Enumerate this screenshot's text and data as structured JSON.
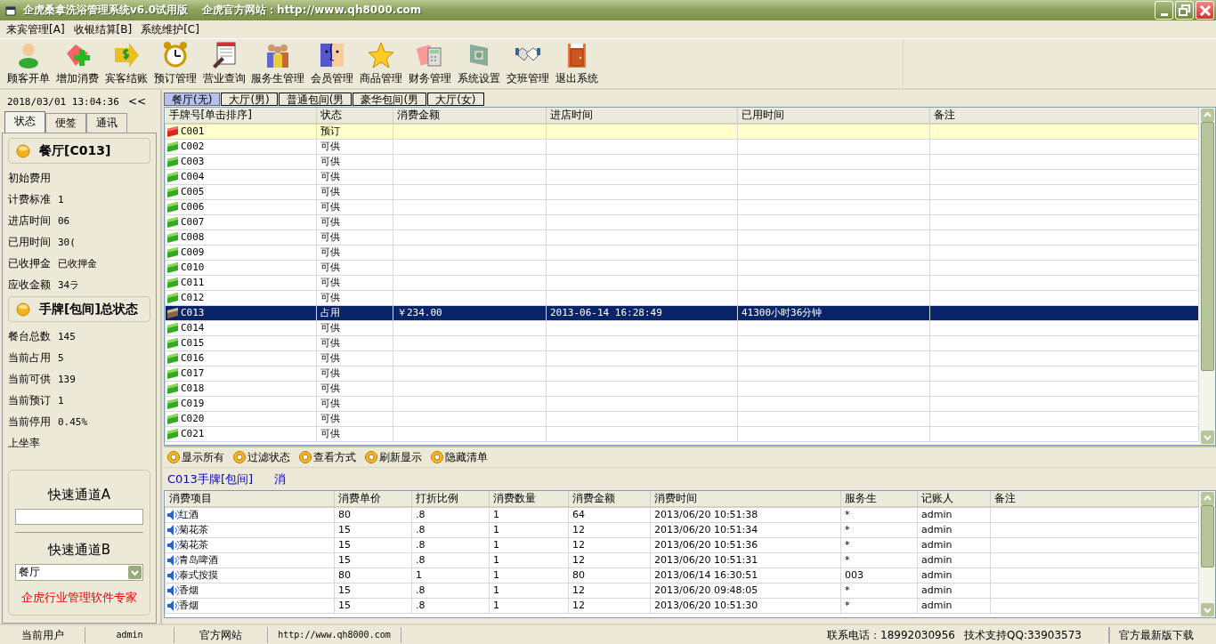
{
  "window": {
    "title": "企虎桑拿洗浴管理系统v6.0试用版",
    "site": "企虎官方网站：http://www.qh8000.com"
  },
  "menu": [
    "来宾管理[A]",
    "收银结算[B]",
    "系统维护[C]"
  ],
  "toolbar": [
    {
      "label": "顾客开单",
      "kind": "person"
    },
    {
      "label": "增加消费",
      "kind": "add"
    },
    {
      "label": "宾客结账",
      "kind": "money"
    },
    {
      "label": "预订管理",
      "kind": "clock"
    },
    {
      "label": "营业查询",
      "kind": "notepad"
    },
    {
      "label": "服务生管理",
      "kind": "people"
    },
    {
      "label": "会员管理",
      "kind": "face"
    },
    {
      "label": "商品管理",
      "kind": "star"
    },
    {
      "label": "财务管理",
      "kind": "calculator"
    },
    {
      "label": "系统设置",
      "kind": "settings"
    },
    {
      "label": "交班管理",
      "kind": "handshake"
    },
    {
      "label": "退出系统",
      "kind": "exit"
    }
  ],
  "sidebar": {
    "datetime": "2018/03/01 13:04:36",
    "collapse": "<<",
    "tabs": [
      {
        "label": "状态",
        "selected": true
      },
      {
        "label": "便签",
        "selected": false
      },
      {
        "label": "通讯",
        "selected": false
      }
    ],
    "room_header": "餐厅[C013]",
    "room_fields": [
      {
        "label": "初始费用"
      },
      {
        "label": "计费标准",
        "value": "1"
      },
      {
        "label": "进店时间",
        "value": "06"
      },
      {
        "label": "已用时间",
        "value": "30("
      },
      {
        "label": "已收押金",
        "value": "已收押金"
      },
      {
        "label": "应收金额",
        "value": "34ラ"
      }
    ],
    "summary_header": "手牌[包间]总状态",
    "summary_fields": [
      {
        "label": "餐台总数",
        "value": "145"
      },
      {
        "label": "当前占用",
        "value": "5"
      },
      {
        "label": "当前可供",
        "value": "139"
      },
      {
        "label": "当前预订",
        "value": "1"
      },
      {
        "label": "当前停用",
        "value": "0.45%"
      },
      {
        "label": "上坐率"
      }
    ],
    "quick_a": {
      "label": "快速通道A"
    },
    "quick_b": {
      "label": "快速通道B",
      "value": "餐厅"
    },
    "slogan": "企虎行业管理软件专家"
  },
  "room_tabs": [
    {
      "label": "餐厅(无)",
      "selected": true
    },
    {
      "label": "大厅(男)",
      "selected": false
    },
    {
      "label": "普通包间(男",
      "selected": false
    },
    {
      "label": "豪华包间(男",
      "selected": false
    },
    {
      "label": "大厅(女)",
      "selected": false
    }
  ],
  "room_table": {
    "columns": [
      "手牌号[单击排序]",
      "状态",
      "消费金额",
      "进店时间",
      "已用时间",
      "备注"
    ],
    "rows": [
      {
        "kind": "reserved",
        "selected": false,
        "cells": [
          "C001",
          "预订",
          "",
          "",
          "",
          ""
        ]
      },
      {
        "kind": "available",
        "selected": false,
        "cells": [
          "C002",
          "可供",
          "",
          "",
          "",
          ""
        ]
      },
      {
        "kind": "available",
        "selected": false,
        "cells": [
          "C003",
          "可供",
          "",
          "",
          "",
          ""
        ]
      },
      {
        "kind": "available",
        "selected": false,
        "cells": [
          "C004",
          "可供",
          "",
          "",
          "",
          ""
        ]
      },
      {
        "kind": "available",
        "selected": false,
        "cells": [
          "C005",
          "可供",
          "",
          "",
          "",
          ""
        ]
      },
      {
        "kind": "available",
        "selected": false,
        "cells": [
          "C006",
          "可供",
          "",
          "",
          "",
          ""
        ]
      },
      {
        "kind": "available",
        "selected": false,
        "cells": [
          "C007",
          "可供",
          "",
          "",
          "",
          ""
        ]
      },
      {
        "kind": "available",
        "selected": false,
        "cells": [
          "C008",
          "可供",
          "",
          "",
          "",
          ""
        ]
      },
      {
        "kind": "available",
        "selected": false,
        "cells": [
          "C009",
          "可供",
          "",
          "",
          "",
          ""
        ]
      },
      {
        "kind": "available",
        "selected": false,
        "cells": [
          "C010",
          "可供",
          "",
          "",
          "",
          ""
        ]
      },
      {
        "kind": "available",
        "selected": false,
        "cells": [
          "C011",
          "可供",
          "",
          "",
          "",
          ""
        ]
      },
      {
        "kind": "available",
        "selected": false,
        "cells": [
          "C012",
          "可供",
          "",
          "",
          "",
          ""
        ]
      },
      {
        "kind": "occupied",
        "selected": true,
        "cells": [
          "C013",
          "占用",
          "￥234.00",
          "2013-06-14 16:28:49",
          "41300小时36分钟",
          ""
        ]
      },
      {
        "kind": "available",
        "selected": false,
        "cells": [
          "C014",
          "可供",
          "",
          "",
          "",
          ""
        ]
      },
      {
        "kind": "available",
        "selected": false,
        "cells": [
          "C015",
          "可供",
          "",
          "",
          "",
          ""
        ]
      },
      {
        "kind": "available",
        "selected": false,
        "cells": [
          "C016",
          "可供",
          "",
          "",
          "",
          ""
        ]
      },
      {
        "kind": "available",
        "selected": false,
        "cells": [
          "C017",
          "可供",
          "",
          "",
          "",
          ""
        ]
      },
      {
        "kind": "available",
        "selected": false,
        "cells": [
          "C018",
          "可供",
          "",
          "",
          "",
          ""
        ]
      },
      {
        "kind": "available",
        "selected": false,
        "cells": [
          "C019",
          "可供",
          "",
          "",
          "",
          ""
        ]
      },
      {
        "kind": "available",
        "selected": false,
        "cells": [
          "C020",
          "可供",
          "",
          "",
          "",
          ""
        ]
      },
      {
        "kind": "available",
        "selected": false,
        "cells": [
          "C021",
          "可供",
          "",
          "",
          "",
          ""
        ]
      }
    ]
  },
  "actions": [
    "显示所有",
    "过滤状态",
    "查看方式",
    "刷新显示",
    "隐藏清单"
  ],
  "detail_title": "C013手牌[包间]",
  "detail_mark": "消",
  "detail_table": {
    "columns": [
      "消费项目",
      "消费单价",
      "打折比例",
      "消费数量",
      "消费金额",
      "消费时间",
      "服务生",
      "记账人",
      "备注"
    ],
    "rows": [
      [
        "红酒",
        "80",
        ".8",
        "1",
        "64",
        "2013/06/20 10:51:38",
        "*",
        "admin",
        ""
      ],
      [
        "菊花茶",
        "15",
        ".8",
        "1",
        "12",
        "2013/06/20 10:51:34",
        "*",
        "admin",
        ""
      ],
      [
        "菊花茶",
        "15",
        ".8",
        "1",
        "12",
        "2013/06/20 10:51:36",
        "*",
        "admin",
        ""
      ],
      [
        "青岛啤酒",
        "15",
        ".8",
        "1",
        "12",
        "2013/06/20 10:51:31",
        "*",
        "admin",
        ""
      ],
      [
        "泰式按摸",
        "80",
        "1",
        "1",
        "80",
        "2013/06/14 16:30:51",
        "003",
        "admin",
        ""
      ],
      [
        "香烟",
        "15",
        ".8",
        "1",
        "12",
        "2013/06/20 09:48:05",
        "*",
        "admin",
        ""
      ],
      [
        "香烟",
        "15",
        ".8",
        "1",
        "12",
        "2013/06/20 10:51:30",
        "*",
        "admin",
        ""
      ]
    ]
  },
  "status_bar": {
    "user_label": "当前用户",
    "user": "admin",
    "site_label": "官方网站",
    "site": "http://www.qh8000.com",
    "phone": "联系电话：18992030956",
    "qq": "技术支持QQ:33903573",
    "download": "官方最新版下载"
  }
}
